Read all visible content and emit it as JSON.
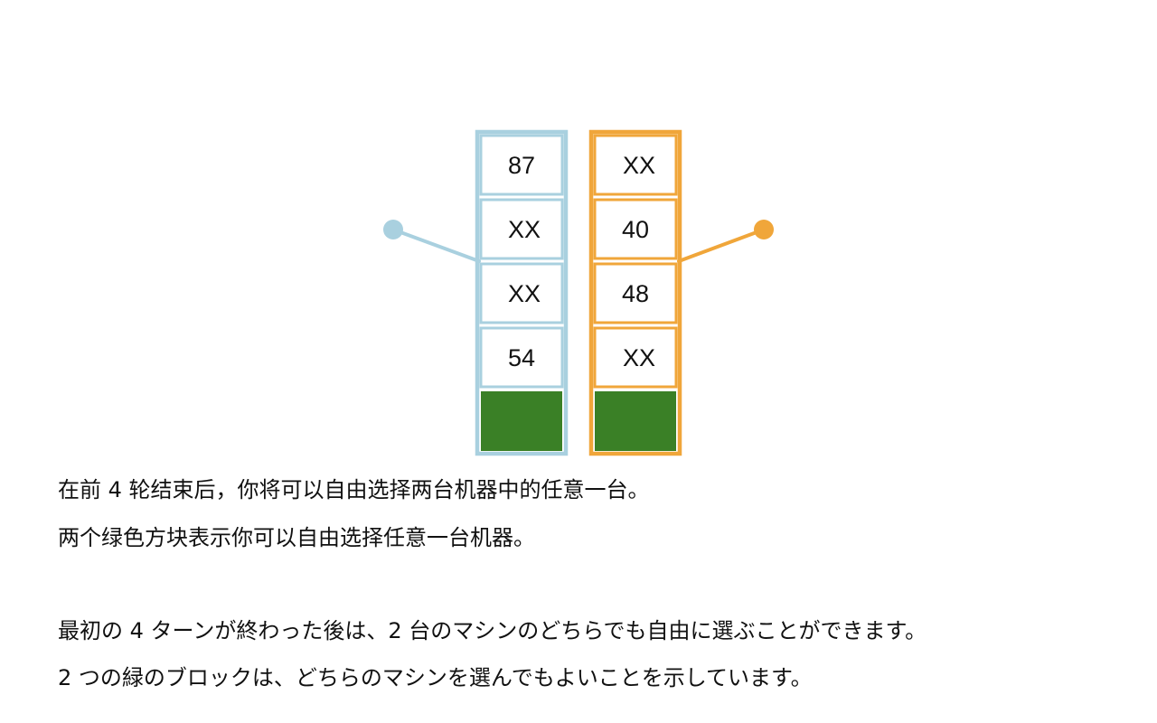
{
  "colors": {
    "left_machine": "#a9d0df",
    "right_machine": "#f0a63a",
    "free_choice_block": "#3a8026",
    "text": "#111111"
  },
  "machines": [
    {
      "name": "left",
      "cells": [
        "87",
        "XX",
        "XX",
        "54"
      ]
    },
    {
      "name": "right",
      "cells": [
        "XX",
        "40",
        "48",
        "XX"
      ]
    }
  ],
  "captions": {
    "zh": [
      "在前 4 轮结束后，你将可以自由选择两台机器中的任意一台。",
      "两个绿色方块表示你可以自由选择任意一台机器。"
    ],
    "ja": [
      "最初の 4 ターンが終わった後は、2 台のマシンのどちらでも自由に選ぶことができます。",
      "2 つの緑のブロックは、どちらのマシンを選んでもよいことを示しています。"
    ]
  }
}
